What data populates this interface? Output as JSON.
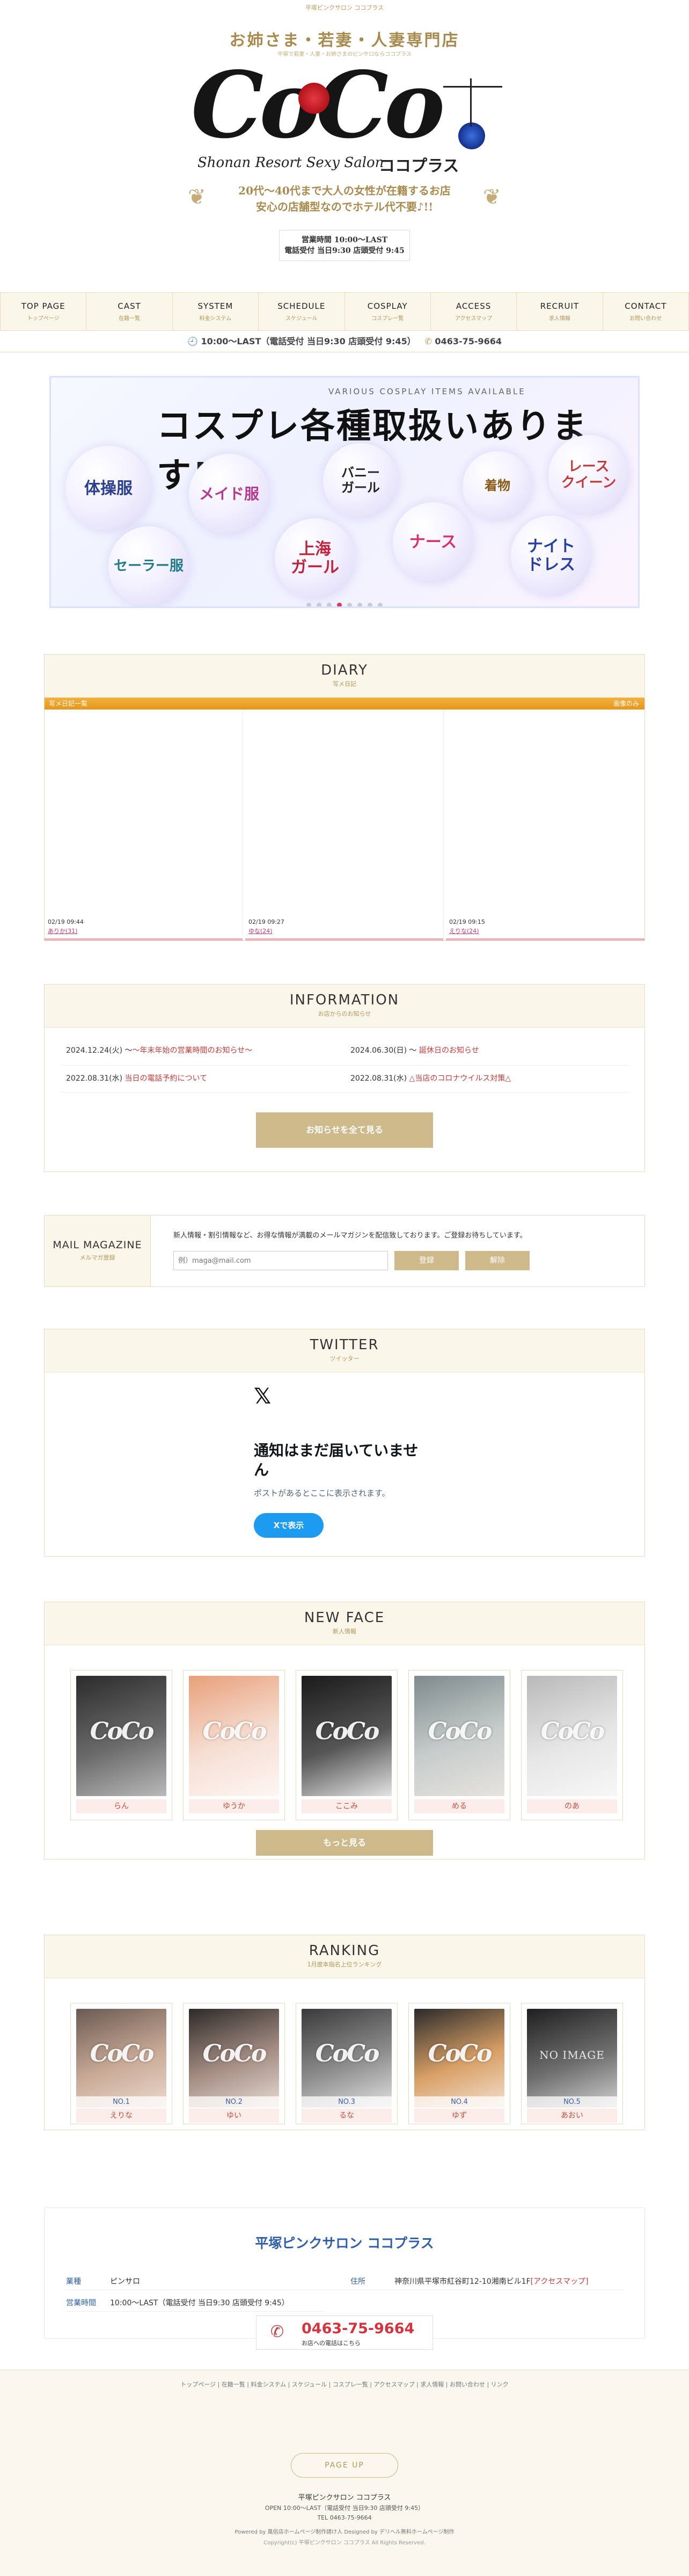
{
  "header": {
    "tagline": "平塚ピンクサロン ココプラス",
    "catchcopy": "お姉さま・若妻・人妻専門店",
    "catchcopy_small": "平塚で若妻・人妻・お姉さまのピンサロならココプラス",
    "logo_text": "CoCo",
    "logo_sub_en": "Shonan Resort Sexy Salon",
    "logo_sub_ja": "ココプラス",
    "lead_1": "20代～40代まで大人の女性が在籍するお店",
    "lead_2": "安心の店舗型なのでホテル代不要♪!!",
    "hours_1": "営業時間 10:00～LAST",
    "hours_2": "電話受付 当日9:30 店頭受付 9:45"
  },
  "nav": [
    {
      "en": "TOP PAGE",
      "ja": "トップページ"
    },
    {
      "en": "CAST",
      "ja": "在籍一覧"
    },
    {
      "en": "SYSTEM",
      "ja": "料金システム"
    },
    {
      "en": "SCHEDULE",
      "ja": "スケジュール"
    },
    {
      "en": "COSPLAY",
      "ja": "コスプレ一覧"
    },
    {
      "en": "ACCESS",
      "ja": "アクセスマップ"
    },
    {
      "en": "RECRUIT",
      "ja": "求人情報"
    },
    {
      "en": "CONTACT",
      "ja": "お問い合わせ"
    }
  ],
  "infobar": {
    "hours": "10:00～LAST（電話受付 当日9:30 店頭受付 9:45）",
    "tel": "0463-75-9664"
  },
  "slider": {
    "title": "コスプレ各種取扱いあります!",
    "subtitle": "VARIOUS COSPLAY ITEMS AVAILABLE",
    "bubbles": [
      "体操服",
      "メイド服",
      "バニー\nガール",
      "着物",
      "レース\nクイーン",
      "セーラー服",
      "上海\nガール",
      "ナース",
      "ナイト\nドレス"
    ]
  },
  "diary": {
    "title_en": "DIARY",
    "title_ja": "写メ日記",
    "bar_label": "写メ日記一覧",
    "bar_right": "画像のみ",
    "entries": [
      {
        "date": "02/19 09:44",
        "name": "ありか(31)"
      },
      {
        "date": "02/19 09:27",
        "name": "ゆな(24)"
      },
      {
        "date": "02/19 09:15",
        "name": "えりな(24)"
      }
    ]
  },
  "information": {
    "title_en": "INFORMATION",
    "title_ja": "お店からのお知らせ",
    "items": [
      {
        "date": "2024.12.24(火)",
        "text": "〜年末年始の営業時間のお知らせ〜"
      },
      {
        "date": "2024.06.30(日)",
        "text": "誕休日のお知らせ"
      },
      {
        "date": "2022.08.31(水)",
        "text": "当日の電話予約について"
      },
      {
        "date": "2022.08.31(水)",
        "text": "△当店のコロナウイルス対策△"
      }
    ],
    "button": "お知らせを全て見る"
  },
  "mail": {
    "title_en": "MAIL MAGAZINE",
    "title_ja": "メルマガ登録",
    "desc": "新人情報・割引情報など、お得な情報が満載のメールマガジンを配信致しております。ご登録お待ちしています。",
    "placeholder": "例）maga@mail.com",
    "register": "登録",
    "cancel": "解除"
  },
  "twitter": {
    "title_en": "TWITTER",
    "title_ja": "ツイッター",
    "x_logo": "𝕏",
    "empty_title": "通知はまだ届いていません",
    "empty_desc": "ポストがあるとここに表示されます。",
    "button": "Xで表示"
  },
  "newface": {
    "title_en": "NEW FACE",
    "title_ja": "新人情報",
    "cast": [
      "らん",
      "ゆうか",
      "ここみ",
      "める",
      "のあ"
    ],
    "button": "もっと見る"
  },
  "ranking": {
    "title_en": "RANKING",
    "title_ja": "1月度本指名上位ランキング",
    "cast": [
      {
        "rank": "NO.1",
        "name": "えりな"
      },
      {
        "rank": "NO.2",
        "name": "ゆい"
      },
      {
        "rank": "NO.3",
        "name": "るな"
      },
      {
        "rank": "NO.4",
        "name": "ゆず"
      },
      {
        "rank": "NO.5",
        "name": "あおい"
      }
    ],
    "no_image": "NO IMAGE"
  },
  "shop": {
    "title": "平塚ピンクサロン ココプラス",
    "type_label": "業種",
    "type_value": "ピンサロ",
    "address_label": "住所",
    "address_value": "神奈川県平塚市紅谷町12-10湘南ビル1F",
    "access_link": "[アクセスマップ]",
    "hours_label": "営業時間",
    "hours_value": "10:00～LAST（電話受付 当日9:30 店頭受付 9:45）",
    "tel": "0463-75-9664",
    "tel_sub": "お店への電話はこちら"
  },
  "footer": {
    "links": "トップページ | 在籍一覧 | 料金システム | スケジュール | コスプレ一覧 | アクセスマップ | 求人情報 | お問い合わせ | リンク",
    "pagetop": "PAGE UP",
    "shop_name": "平塚ピンクサロン ココプラス",
    "open": "OPEN 10:00～LAST（電話受付 当日9:30 店頭受付 9:45）",
    "tel": "TEL 0463-75-9664",
    "powered": "Powered by 風俗店ホームページ制作請け人 Designed by デリヘル無料ホームページ制作",
    "copyright": "Copyright(c) 平塚ピンクサロン ココプラス All Rights Reserved."
  },
  "colors": {
    "gold": "#cdb98a",
    "accent_red": "#c63b3b",
    "blue": "#2f5fa9",
    "diary_bar": "#e7961a"
  }
}
